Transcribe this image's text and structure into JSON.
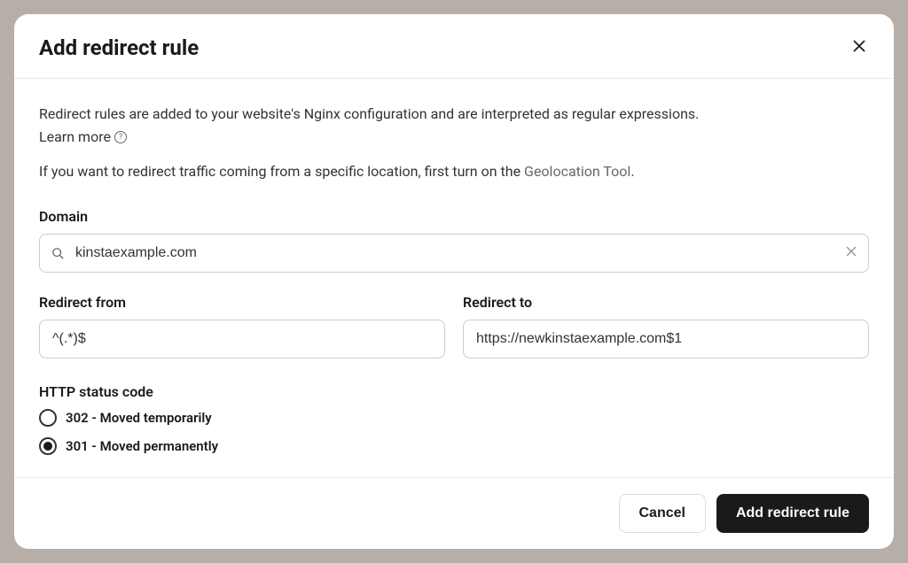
{
  "modal": {
    "title": "Add redirect rule",
    "description": "Redirect rules are added to your website's Nginx configuration and are interpreted as regular expressions.",
    "learn_more": "Learn more",
    "geo_prefix": "If you want to redirect traffic coming from a specific location, first turn on the ",
    "geo_link": "Geolocation Tool",
    "geo_suffix": "."
  },
  "form": {
    "domain": {
      "label": "Domain",
      "value": "kinstaexample.com"
    },
    "redirect_from": {
      "label": "Redirect from",
      "value": "^(.*)$"
    },
    "redirect_to": {
      "label": "Redirect to",
      "value": "https://newkinstaexample.com$1"
    },
    "status_code": {
      "label": "HTTP status code",
      "options": [
        {
          "label": "302 - Moved temporarily",
          "selected": false
        },
        {
          "label": "301 - Moved permanently",
          "selected": true
        }
      ]
    }
  },
  "footer": {
    "cancel": "Cancel",
    "submit": "Add redirect rule"
  }
}
